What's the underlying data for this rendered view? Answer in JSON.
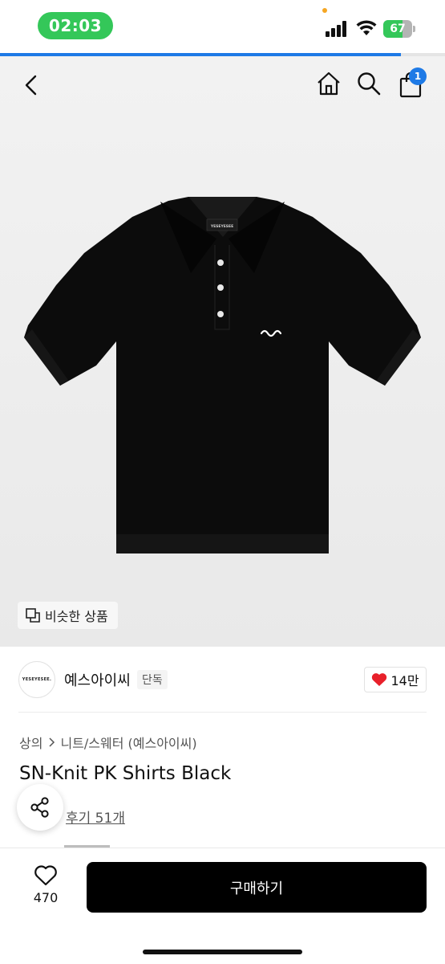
{
  "status_bar": {
    "time": "02:03",
    "battery_percent": "67",
    "battery_level": 0.67
  },
  "page_progress": 0.9,
  "header": {
    "cart_count": "1"
  },
  "product_image": {
    "similar_products_label": "비슷한 상품",
    "brand_tag_text": "YESEYESEE"
  },
  "brand": {
    "logo_text": "YESEYESEE.",
    "name": "예스아이씨",
    "tag": "단독",
    "likes": "14만"
  },
  "breadcrumb": {
    "category": "상의",
    "subcategory": "니트/스웨터 (예스아이씨)"
  },
  "product": {
    "title": "SN-Knit PK Shirts Black",
    "reviews": "후기 51개"
  },
  "bottom_bar": {
    "wish_count": "470",
    "buy_label": "구매하기"
  },
  "colors": {
    "status_green": "#34c759",
    "accent_blue": "#1e7ae6",
    "heart_red": "#e8202a",
    "buy_black": "#000000"
  }
}
